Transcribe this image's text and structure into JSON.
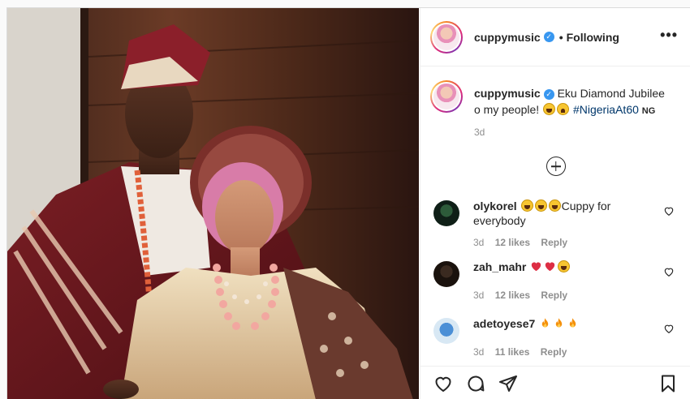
{
  "post": {
    "username": "cuppymusic",
    "follow_separator": "•",
    "follow_status": "Following",
    "more_label": "•••"
  },
  "caption": {
    "username": "cuppymusic",
    "text": "Eku Diamond Jubilee o my people!",
    "hashtag": "#NigeriaAt60",
    "country_tag": "NG",
    "time": "3d"
  },
  "comments": [
    {
      "username": "olykorel",
      "text": "Cuppy for everybody",
      "time": "3d",
      "likes": "12 likes",
      "reply": "Reply",
      "emojis": [
        "laugh",
        "laugh",
        "laugh"
      ]
    },
    {
      "username": "zah_mahr",
      "text": "",
      "time": "3d",
      "likes": "12 likes",
      "reply": "Reply",
      "emojis": [
        "heart",
        "heart",
        "laugh"
      ]
    },
    {
      "username": "adetoyese7",
      "text": "",
      "time": "3d",
      "likes": "11 likes",
      "reply": "Reply",
      "emojis": [
        "fire",
        "fire",
        "fire"
      ]
    }
  ],
  "icons": {
    "like": "heart-icon",
    "comment": "comment-icon",
    "share": "share-icon",
    "save": "bookmark-icon",
    "load_more": "plus-circle-icon",
    "verified": "verified-badge-icon"
  },
  "colors": {
    "verified": "#3897f0",
    "hashtag": "#00376b",
    "muted": "#8e8e8e",
    "heart": "#ed4956",
    "fire": "#f4900c"
  }
}
